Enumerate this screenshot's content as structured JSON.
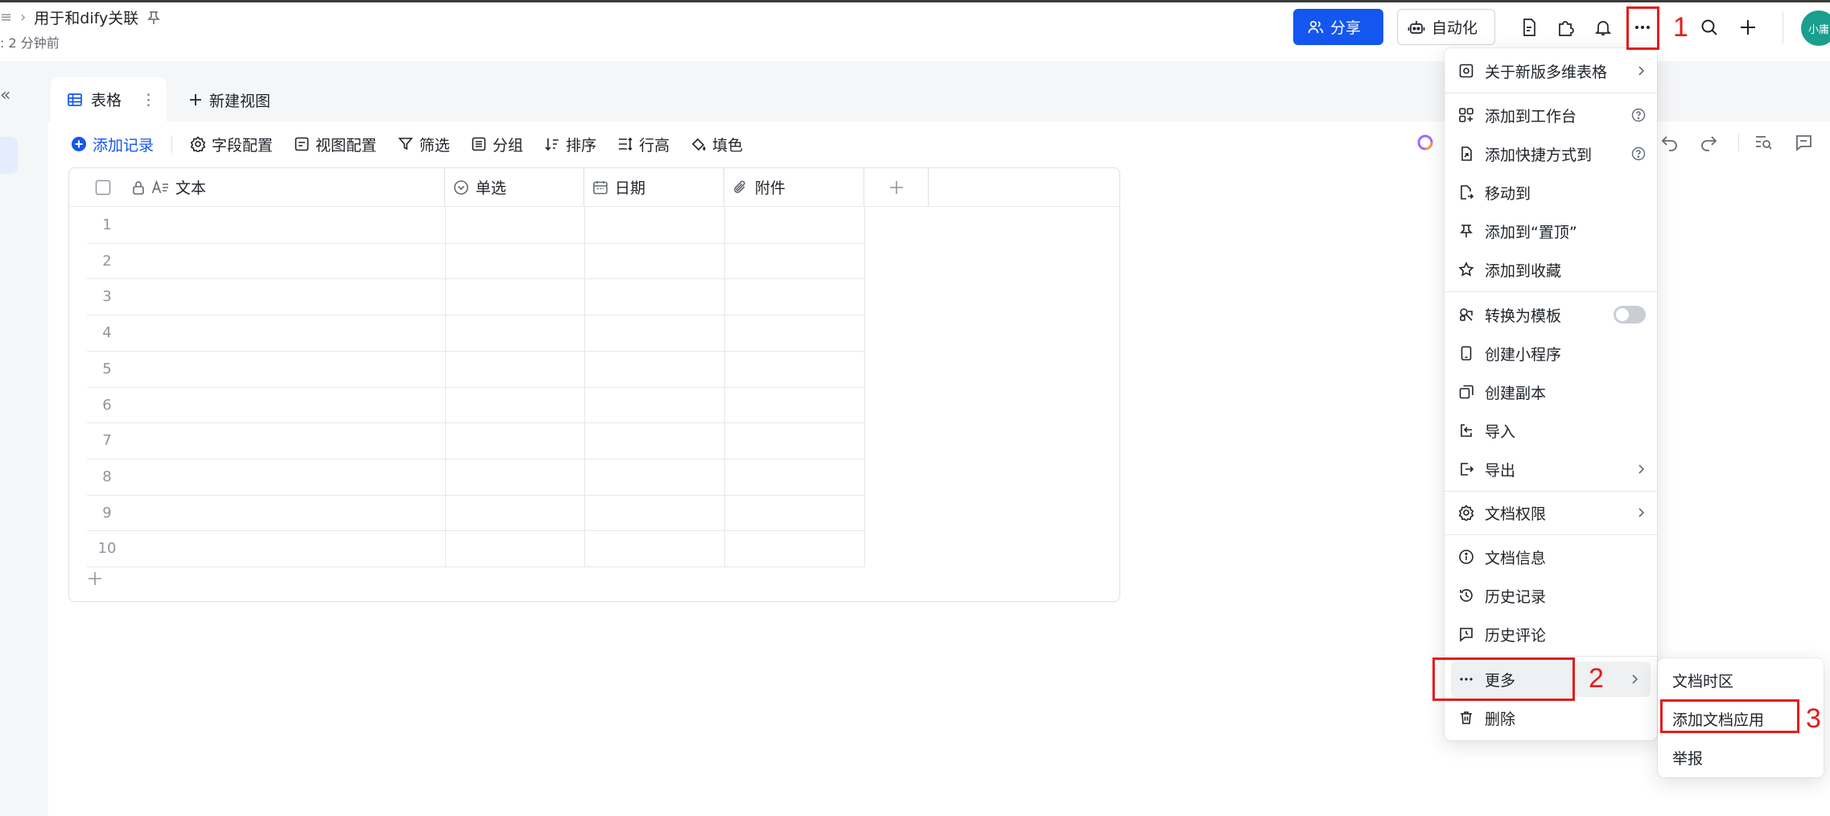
{
  "header": {
    "breadcrumb_title": "用于和dify关联",
    "subline": ": 2 分钟前",
    "share_label": "分享",
    "automation_label": "自动化",
    "avatar_text": "小庸"
  },
  "tabs": {
    "active_label": "表格",
    "new_view_label": "新建视图"
  },
  "toolbar": {
    "add_record": "添加记录",
    "field_config": "字段配置",
    "view_config": "视图配置",
    "filter": "筛选",
    "group": "分组",
    "sort": "排序",
    "row_height": "行高",
    "fill_color": "填色"
  },
  "table": {
    "columns": [
      "文本",
      "单选",
      "日期",
      "附件"
    ],
    "rows": [
      "1",
      "2",
      "3",
      "4",
      "5",
      "6",
      "7",
      "8",
      "9",
      "10"
    ]
  },
  "menu": {
    "about_new": "关于新版多维表格",
    "add_to_workbench": "添加到工作台",
    "add_shortcut": "添加快捷方式到",
    "move_to": "移动到",
    "pin_top": "添加到“置顶”",
    "add_favorite": "添加到收藏",
    "convert_template": "转换为模板",
    "create_miniapp": "创建小程序",
    "create_copy": "创建副本",
    "import": "导入",
    "export": "导出",
    "doc_permission": "文档权限",
    "doc_info": "文档信息",
    "history": "历史记录",
    "history_comments": "历史评论",
    "more": "更多",
    "delete": "删除"
  },
  "submenu": {
    "timezone": "文档时区",
    "add_doc_app": "添加文档应用",
    "report": "举报"
  },
  "annotations": {
    "step1": "1",
    "step2": "2",
    "step3": "3",
    "color": "#e21d1d"
  },
  "colors": {
    "accent": "#1456f0",
    "avatar": "#1a9e8e"
  }
}
